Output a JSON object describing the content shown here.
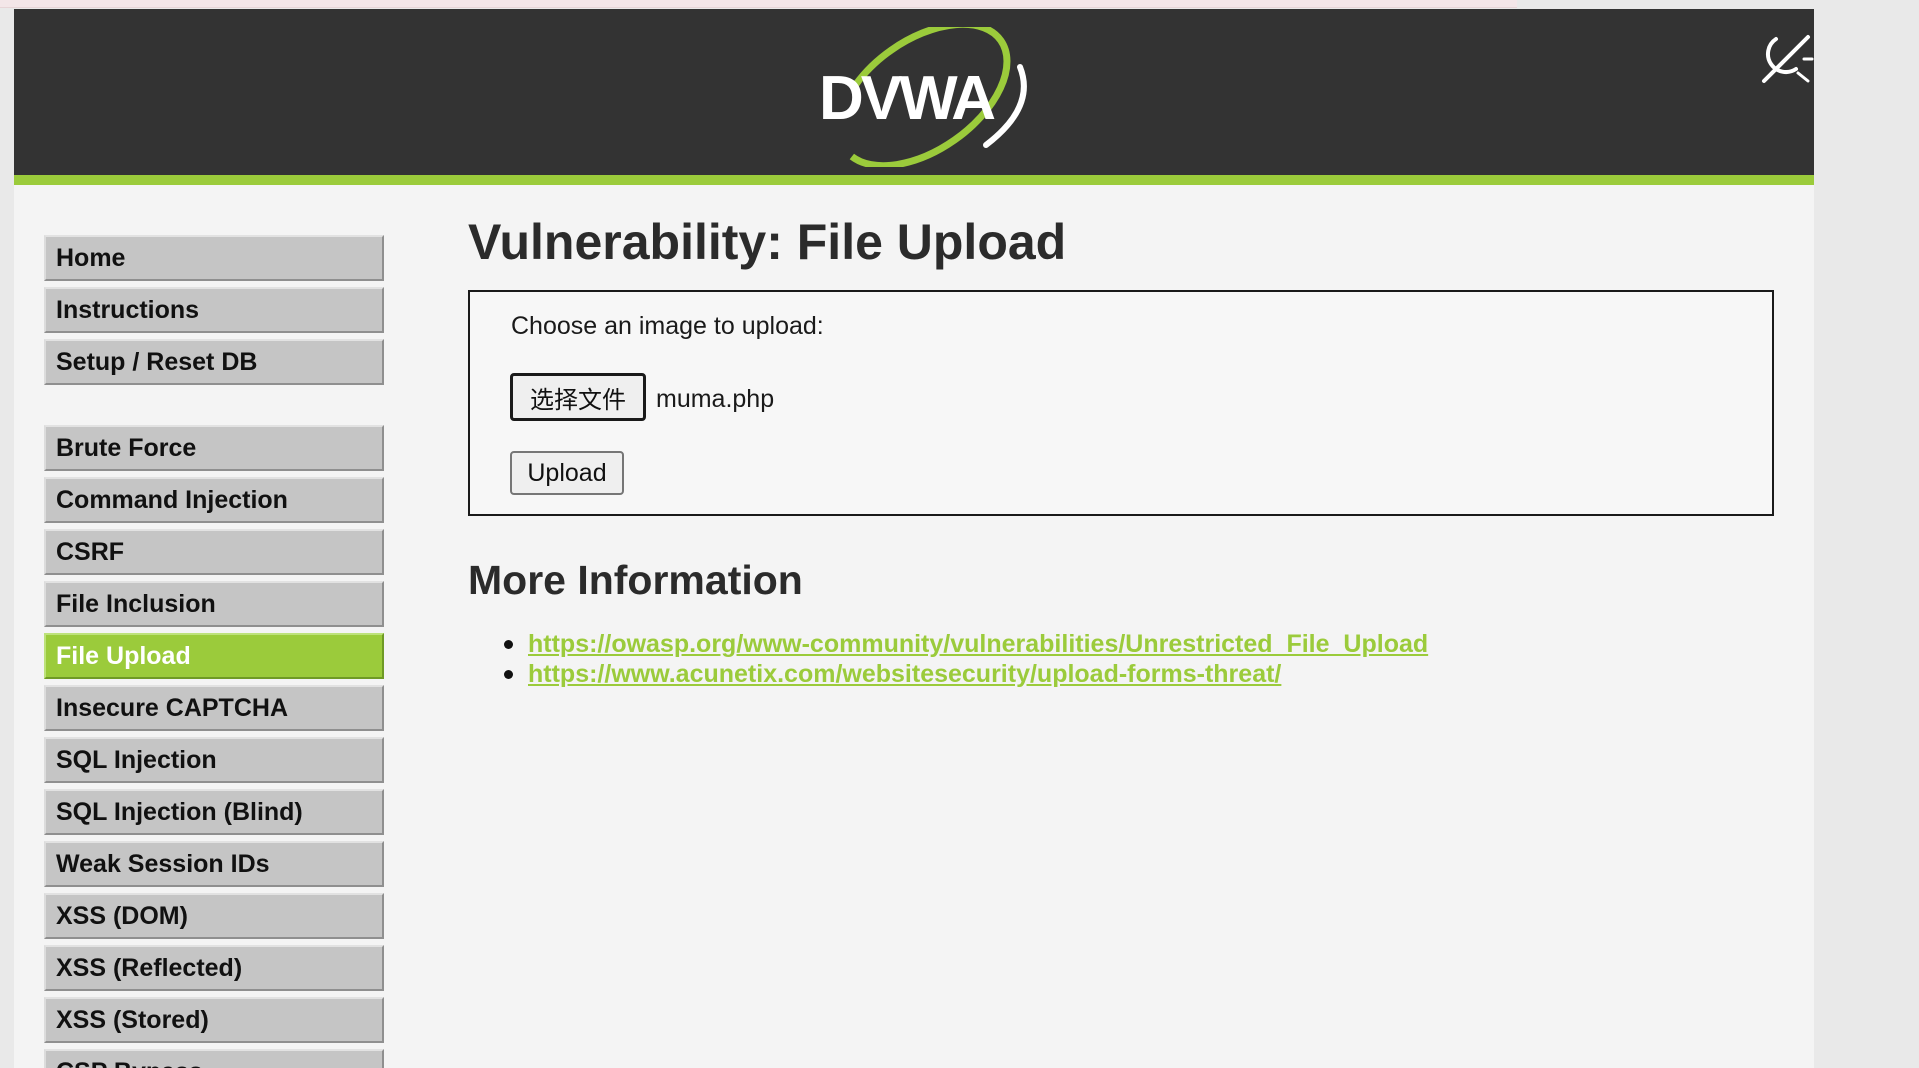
{
  "header": {
    "logo_text": "DVWA",
    "theme_toggle_icon": "theme-toggle-icon"
  },
  "sidebar": {
    "group_one": [
      {
        "label": "Home"
      },
      {
        "label": "Instructions"
      },
      {
        "label": "Setup / Reset DB"
      }
    ],
    "group_two": [
      {
        "label": "Brute Force"
      },
      {
        "label": "Command Injection"
      },
      {
        "label": "CSRF"
      },
      {
        "label": "File Inclusion"
      },
      {
        "label": "File Upload",
        "selected": true
      },
      {
        "label": "Insecure CAPTCHA"
      },
      {
        "label": "SQL Injection"
      },
      {
        "label": "SQL Injection (Blind)"
      },
      {
        "label": "Weak Session IDs"
      },
      {
        "label": "XSS (DOM)"
      },
      {
        "label": "XSS (Reflected)"
      },
      {
        "label": "XSS (Stored)"
      },
      {
        "label": "CSP Bypass"
      }
    ]
  },
  "main": {
    "title": "Vulnerability: File Upload",
    "upload_form": {
      "prompt": "Choose an image to upload:",
      "choose_file_label": "选择文件",
      "selected_file": "muma.php",
      "upload_label": "Upload"
    },
    "more_info": {
      "title": "More Information",
      "links": [
        "https://owasp.org/www-community/vulnerabilities/Unrestricted_File_Upload",
        "https://www.acunetix.com/websitesecurity/upload-forms-threat/"
      ]
    }
  },
  "colors": {
    "header_bg": "#333333",
    "accent_green": "#9bcb3b",
    "page_bg": "#f4f4f4",
    "menu_item_bg": "#c5c5c5"
  }
}
